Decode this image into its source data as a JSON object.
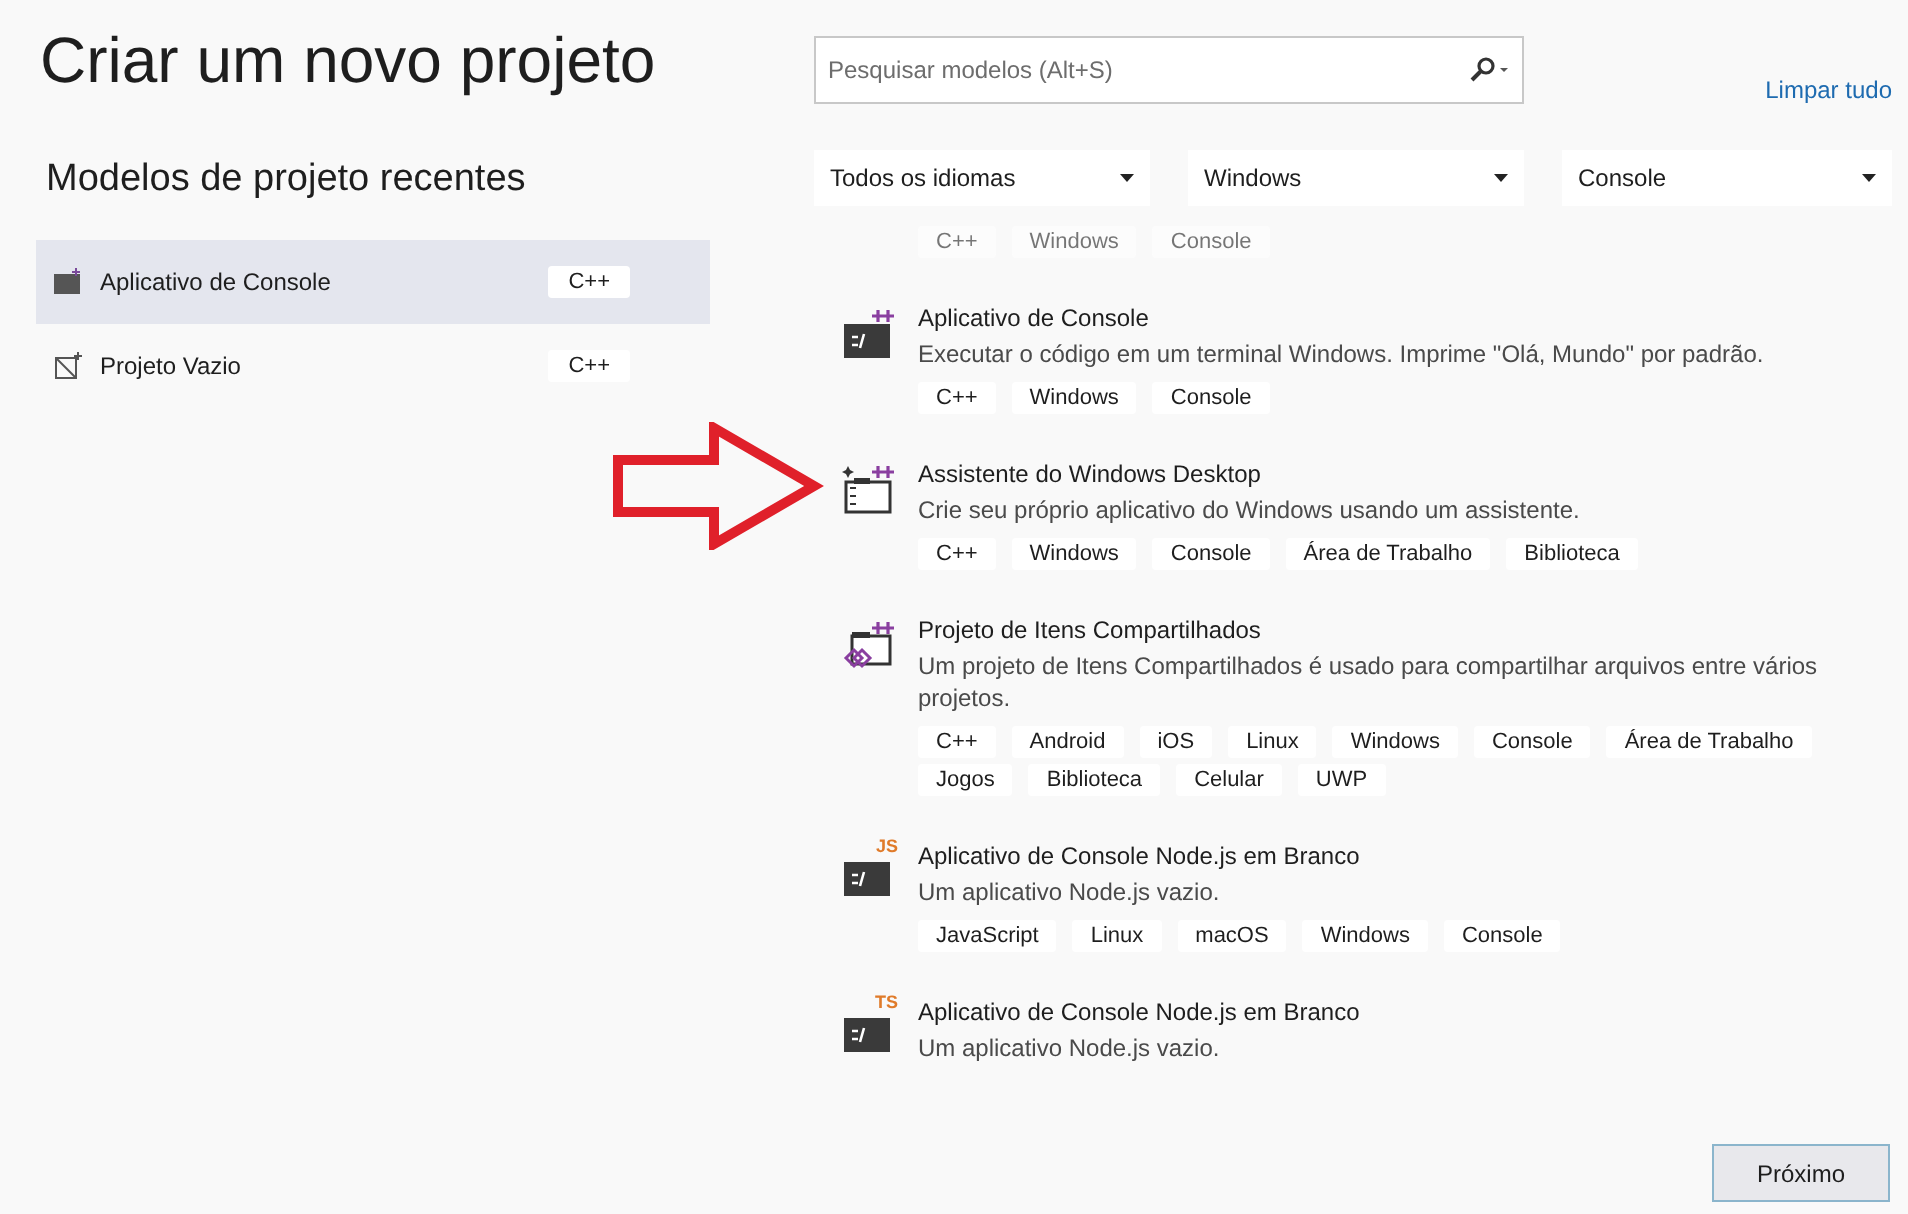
{
  "title": "Criar um novo projeto",
  "recent": {
    "heading": "Modelos de projeto recentes",
    "items": [
      {
        "name": "Aplicativo de Console",
        "tag": "C++",
        "kind": "console",
        "selected": true
      },
      {
        "name": "Projeto Vazio",
        "tag": "C++",
        "kind": "empty",
        "selected": false
      }
    ]
  },
  "search": {
    "placeholder": "Pesquisar modelos (Alt+S)"
  },
  "clear_link": "Limpar tudo",
  "filters": [
    "Todos os idiomas",
    "Windows",
    "Console"
  ],
  "partial_tags": [
    "C++",
    "Windows",
    "Console"
  ],
  "templates": [
    {
      "kind": "console",
      "name": "Aplicativo de Console",
      "description": "Executar o código em um terminal Windows. Imprime \"Olá, Mundo\" por padrão.",
      "tags": [
        "C++",
        "Windows",
        "Console"
      ]
    },
    {
      "kind": "wizard",
      "name": "Assistente do Windows Desktop",
      "description": "Crie seu próprio aplicativo do Windows usando um assistente.",
      "tags": [
        "C++",
        "Windows",
        "Console",
        "Área de Trabalho",
        "Biblioteca"
      ]
    },
    {
      "kind": "shared",
      "name": "Projeto de Itens Compartilhados",
      "description": "Um projeto de Itens Compartilhados é usado para compartilhar arquivos entre vários projetos.",
      "tags": [
        "C++",
        "Android",
        "iOS",
        "Linux",
        "Windows",
        "Console",
        "Área de Trabalho",
        "Jogos",
        "Biblioteca",
        "Celular",
        "UWP"
      ]
    },
    {
      "kind": "script-console",
      "badge": "JS",
      "name": "Aplicativo de Console Node.js em Branco",
      "description": "Um aplicativo Node.js vazio.",
      "tags": [
        "JavaScript",
        "Linux",
        "macOS",
        "Windows",
        "Console"
      ]
    },
    {
      "kind": "script-console",
      "badge": "TS",
      "name": "Aplicativo de Console Node.js em Branco",
      "description": "Um aplicativo Node.js vazio."
    }
  ],
  "next_button": "Próximo"
}
